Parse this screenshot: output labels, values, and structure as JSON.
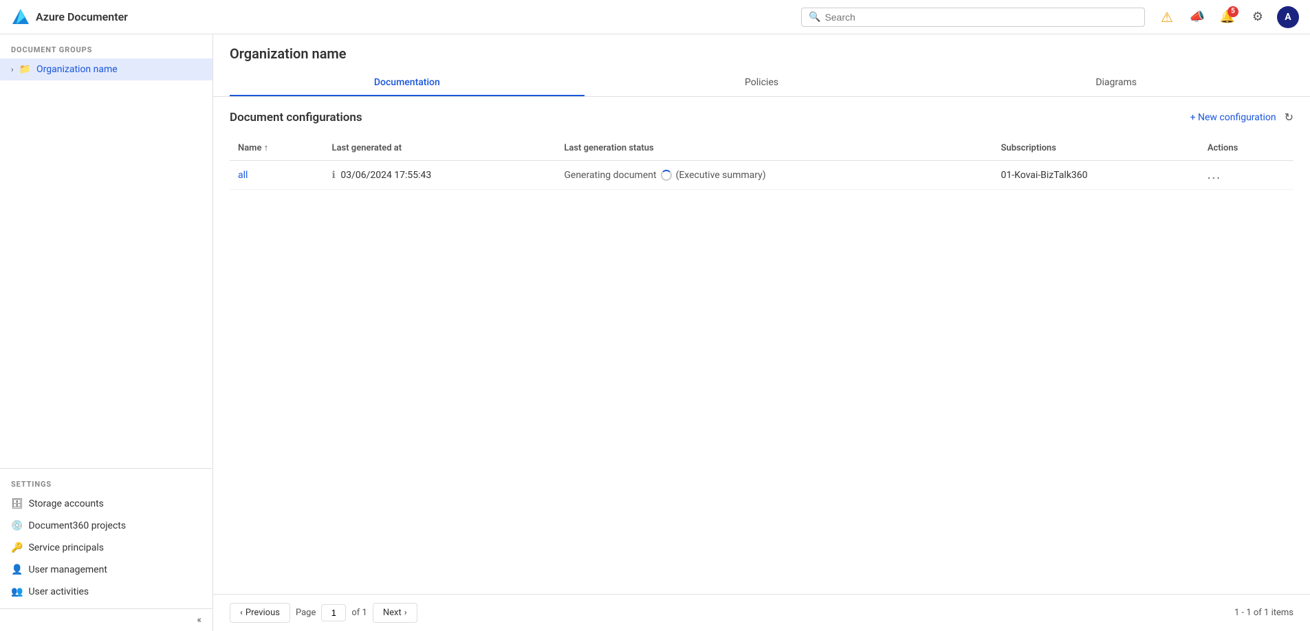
{
  "app": {
    "title": "Azure Documenter",
    "logo_text": "Azure Documenter"
  },
  "header": {
    "search_placeholder": "Search",
    "notification_badge": "5",
    "avatar_initial": "A"
  },
  "sidebar": {
    "document_groups_label": "DOCUMENT GROUPS",
    "items": [
      {
        "id": "org",
        "label": "Organization name",
        "active": true,
        "type": "folder"
      }
    ],
    "settings_label": "SETTINGS",
    "settings_items": [
      {
        "id": "storage",
        "label": "Storage accounts",
        "icon": "storage-icon"
      },
      {
        "id": "doc360",
        "label": "Document360 projects",
        "icon": "doc360-icon"
      },
      {
        "id": "service",
        "label": "Service principals",
        "icon": "service-icon"
      },
      {
        "id": "usermgmt",
        "label": "User management",
        "icon": "user-mgmt-icon"
      },
      {
        "id": "useract",
        "label": "User activities",
        "icon": "user-act-icon"
      }
    ],
    "collapse_label": "«"
  },
  "main": {
    "title": "Organization name",
    "tabs": [
      {
        "id": "documentation",
        "label": "Documentation",
        "active": true
      },
      {
        "id": "policies",
        "label": "Policies",
        "active": false
      },
      {
        "id": "diagrams",
        "label": "Diagrams",
        "active": false
      }
    ],
    "content_title": "Document configurations",
    "new_config_label": "+ New configuration",
    "table": {
      "columns": [
        "Name ↑",
        "Last generated at",
        "Last generation status",
        "Subscriptions",
        "Actions"
      ],
      "rows": [
        {
          "name": "all",
          "last_generated": "03/06/2024 17:55:43",
          "status": "Generating document",
          "status_detail": "(Executive summary)",
          "subscriptions": "01-Kovai-BizTalk360",
          "actions": "..."
        }
      ]
    },
    "pagination": {
      "previous_label": "Previous",
      "next_label": "Next",
      "page_label": "Page",
      "of_label": "of 1",
      "current_page": "1",
      "summary": "1 - 1 of 1 items"
    }
  }
}
